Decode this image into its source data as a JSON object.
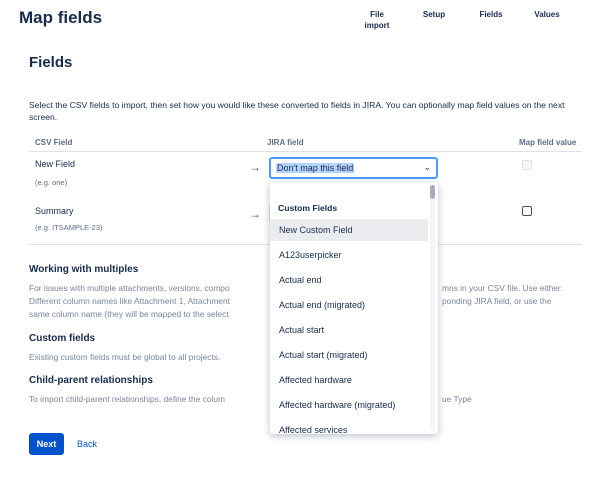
{
  "header": {
    "title": "Map fields",
    "steps": [
      {
        "line1": "File",
        "line2": "import"
      },
      {
        "line1": "Setup",
        "line2": ""
      },
      {
        "line1": "Fields",
        "line2": ""
      },
      {
        "line1": "Values",
        "line2": ""
      }
    ]
  },
  "main": {
    "title": "Fields",
    "intro": "Select the CSV fields to import, then set how you would like these converted to fields in JIRA. You can optionally map field values on the next screen.",
    "columns": {
      "csv": "CSV Field",
      "jira": "JIRA field",
      "map": "Map field value"
    },
    "rows": [
      {
        "name": "New Field",
        "example": "(e.g. one)",
        "selected": "Don't map this field"
      },
      {
        "name": "Summary",
        "example": "(e.g. ITSAMPLE-23)",
        "selected": ""
      }
    ],
    "arrow_icon": "arrow-right-icon",
    "chevron_icon": "chevron-down-icon"
  },
  "dropdown": {
    "group_label": "Custom Fields",
    "items": [
      "New Custom Field",
      "A123userpicker",
      "Actual end",
      "Actual end (migrated)",
      "Actual start",
      "Actual start (migrated)",
      "Affected hardware",
      "Affected hardware (migrated)",
      "Affected services"
    ],
    "hovered_index": 0
  },
  "help": {
    "multiples_title": "Working with multiples",
    "multiples_line1a": "For issues with multiple attachments, versions, compo",
    "multiples_line1b": "mns in your CSV file. Use either:",
    "multiples_line2a": "Different column names like Attachment 1, Attachment",
    "multiples_line2b": "ponding JIRA field, or use the",
    "multiples_line3a": "same column name (they will be mapped to the select",
    "custom_title": "Custom fields",
    "custom_text": "Existing custom fields must be global to all projects.",
    "child_title": "Child-parent relationships",
    "child_text_a": "To import child-parent relationships, define the colum",
    "child_text_b": "ue Type"
  },
  "actions": {
    "next": "Next",
    "back": "Back"
  },
  "colors": {
    "primary": "#0052cc",
    "focus": "#4c9aff",
    "hover": "#ebecf0",
    "text": "#172b4d"
  }
}
